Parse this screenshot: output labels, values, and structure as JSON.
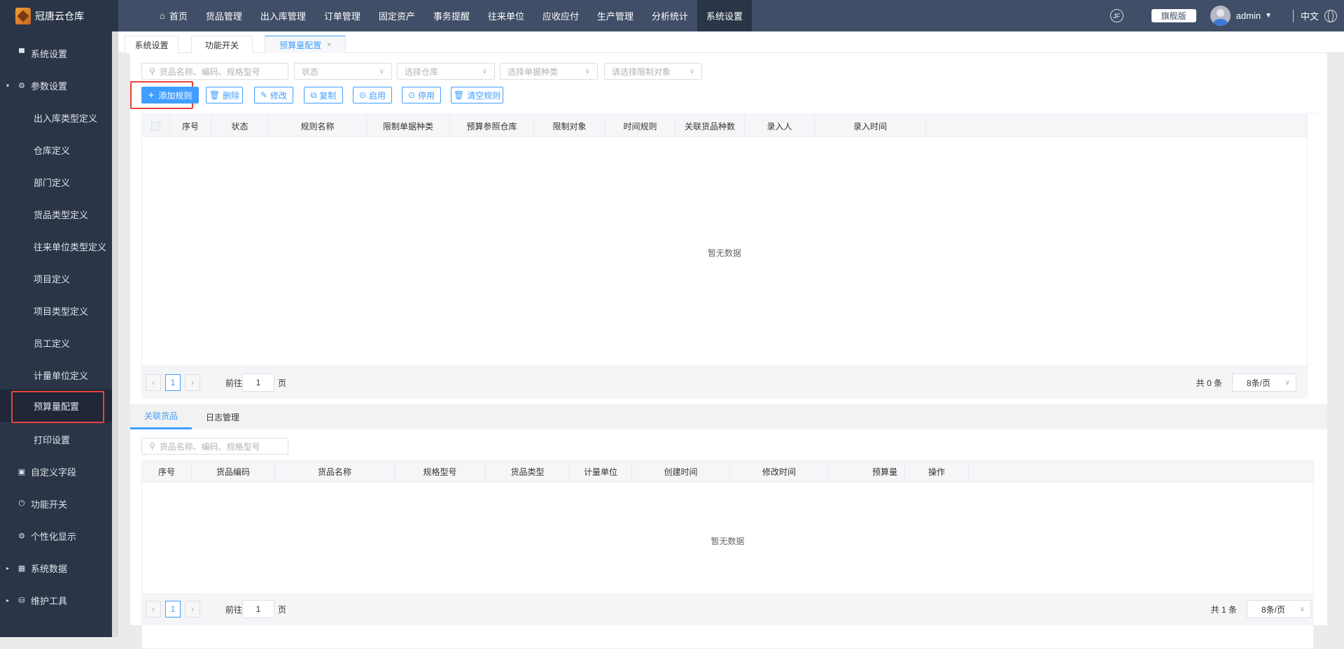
{
  "app": {
    "name": "冠唐云仓库"
  },
  "nav": [
    "首页",
    "货品管理",
    "出入库管理",
    "订单管理",
    "固定资产",
    "事务提醒",
    "往来单位",
    "应收应付",
    "生产管理",
    "分析统计",
    "系统设置"
  ],
  "header": {
    "edition": "旗舰版",
    "user": "admin",
    "lang": "中文",
    "jf_icon": "JF"
  },
  "sidebar": [
    {
      "label": "系统设置",
      "level": "top",
      "icon": "▀"
    },
    {
      "label": "参数设置",
      "level": "top",
      "icon": "⚙",
      "arrow": "▾"
    },
    {
      "label": "出入库类型定义",
      "level": "sub"
    },
    {
      "label": "仓库定义",
      "level": "sub"
    },
    {
      "label": "部门定义",
      "level": "sub"
    },
    {
      "label": "货品类型定义",
      "level": "sub"
    },
    {
      "label": "往来单位类型定义",
      "level": "sub"
    },
    {
      "label": "项目定义",
      "level": "sub"
    },
    {
      "label": "项目类型定义",
      "level": "sub"
    },
    {
      "label": "员工定义",
      "level": "sub"
    },
    {
      "label": "计量单位定义",
      "level": "sub"
    },
    {
      "label": "预算量配置",
      "level": "sub",
      "selected": true
    },
    {
      "label": "打印设置",
      "level": "sub"
    },
    {
      "label": "自定义字段",
      "level": "top",
      "icon": "▣"
    },
    {
      "label": "功能开关",
      "level": "top",
      "icon": "⏻"
    },
    {
      "label": "个性化显示",
      "level": "top",
      "icon": "⚙"
    },
    {
      "label": "系统数据",
      "level": "top",
      "icon": "▦",
      "arrow": "▸"
    },
    {
      "label": "维护工具",
      "level": "top",
      "icon": "⛁",
      "arrow": "▸"
    }
  ],
  "tabs": [
    {
      "label": "系统设置"
    },
    {
      "label": "功能开关"
    },
    {
      "label": "预算量配置",
      "active": true,
      "close": "×"
    }
  ],
  "filters": {
    "search_placeholder": "货品名称、编码、规格型号",
    "status": "状态",
    "warehouse": "选择仓库",
    "doc_type": "选择单据种类",
    "target": "请选择限制对象"
  },
  "buttons": {
    "add": "添加规则",
    "delete": "删除",
    "edit": "修改",
    "copy": "复制",
    "enable": "启用",
    "disable": "停用",
    "clear": "清空规则"
  },
  "rules_table": {
    "columns": [
      "序号",
      "状态",
      "规则名称",
      "限制单据种类",
      "预算参照仓库",
      "限制对象",
      "时间规则",
      "关联货品种数",
      "录入人",
      "录入时间"
    ],
    "empty": "暂无数据"
  },
  "pager1": {
    "page": "1",
    "goto_label": "前往",
    "goto_value": "1",
    "page_unit": "页",
    "total": "共 0 条",
    "size": "8条/页"
  },
  "bottom_tabs": [
    "关联货品",
    "日志管理"
  ],
  "goods": {
    "search_placeholder": "货品名称、编码、规格型号",
    "columns": [
      "序号",
      "货品编码",
      "货品名称",
      "规格型号",
      "货品类型",
      "计量单位",
      "创建时间",
      "修改时间",
      "预算量",
      "操作"
    ],
    "empty": "暂无数据"
  },
  "pager2": {
    "page": "1",
    "goto_label": "前往",
    "goto_value": "1",
    "page_unit": "页",
    "total": "共 1 条",
    "size": "8条/页"
  }
}
